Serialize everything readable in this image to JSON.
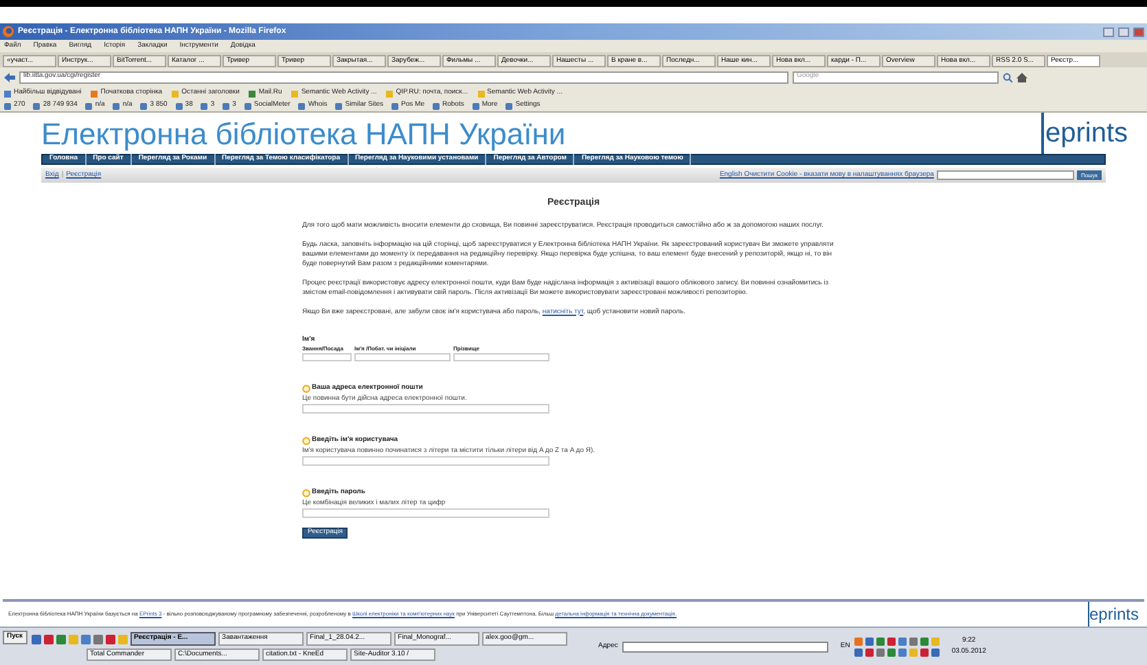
{
  "window": {
    "title": "Реєстрація - Електронна бібліотека НАПН України - Mozilla Firefox"
  },
  "menu": [
    "Файл",
    "Правка",
    "Вигляд",
    "Історія",
    "Закладки",
    "Інструменти",
    "Довідка"
  ],
  "tabs": [
    {
      "label": "«участ...",
      "selected": false
    },
    {
      "label": "Инструк...",
      "selected": false
    },
    {
      "label": "BitTorrent...",
      "selected": false
    },
    {
      "label": "Каталог ...",
      "selected": false
    },
    {
      "label": "Тривер",
      "selected": false
    },
    {
      "label": "Тривер",
      "selected": false
    },
    {
      "label": "Закрытая...",
      "selected": false
    },
    {
      "label": "Зарубеж...",
      "selected": false
    },
    {
      "label": "Фильмы ...",
      "selected": false
    },
    {
      "label": "Девочки...",
      "selected": false
    },
    {
      "label": "Нашесты ...",
      "selected": false
    },
    {
      "label": "В кране в...",
      "selected": false
    },
    {
      "label": "Последн...",
      "selected": false
    },
    {
      "label": "Наше кин...",
      "selected": false
    },
    {
      "label": "Нова вкл...",
      "selected": false
    },
    {
      "label": "карди - П...",
      "selected": false
    },
    {
      "label": "Overview",
      "selected": false
    },
    {
      "label": "Нова вкл...",
      "selected": false
    },
    {
      "label": "RSS 2.0 S...",
      "selected": false
    },
    {
      "label": "Реєстр...",
      "selected": true
    }
  ],
  "address": {
    "value": "lib.iitta.gov.ua/cgi/register"
  },
  "web_search": {
    "placeholder": "Google"
  },
  "bookmarks": [
    "Найбільш відвідувані",
    "Початкова сторінка",
    "Останні заголовки",
    "Mail.Ru",
    "Semantic Web Activity ...",
    "QIP.RU: почта, поиск...",
    "Semantic Web Activity ..."
  ],
  "seo_bar": [
    "270",
    "28 749 934",
    "n/a",
    "n/a",
    "3 850",
    "38",
    "3",
    "3",
    "SocialMeter",
    "Whois",
    "Similar Sites",
    "Pos Me",
    "Robots",
    "More",
    "Settings"
  ],
  "site": {
    "title": "Електронна бібліотека НАПН України",
    "logo": "eprints"
  },
  "nav": [
    "Головна",
    "Про сайт",
    "Перегляд за Роками",
    "Перегляд за Темою класифікатора",
    "Перегляд за Науковими установами",
    "Перегляд за Автором",
    "Перегляд за Науковою темою"
  ],
  "login_links": [
    "Вхід",
    "Реєстрація"
  ],
  "login_separator": "|",
  "language_note": "English Очистити Cookie - вказати мову в налаштуваннях браузера",
  "search_button": "Пошук",
  "page": {
    "heading": "Реєстрація",
    "paragraphs": [
      "Для того щоб мати можливість вносити елементи до сховища, Ви повинні зареєструватися. Реєстрація проводиться самостійно або ж за допомогою наших послуг.",
      "Будь ласка, заповніть інформацію на цій сторінці, щоб зареєструватися у Електронна бібліотека НАПН України. Як зареєстрований користувач Ви зможете управляти вашими елементами до моменту їх передавання на редакційну перевірку. Якщо перевірка буде успішна, то ваш елемент буде внесений у репозиторій, якщо ні, то він буде повернутий Вам разом з редакційними коментарями.",
      "Процес реєстрації використовує адресу електронної пошти, куди Вам буде надіслана інформація з активізації вашого облікового запису. Ви повинні ознайомитись із змістом email-повідомлення і активувати свій пароль. Після активізації Ви можете використовувати зареєстровані можливості репозиторію."
    ],
    "forgot": {
      "before": "Якщо Ви вже зареєстровані, але забули своє ім'я користувача або пароль,",
      "link": "натисніть тут",
      "after": ", щоб установити новий пароль."
    },
    "name_label": "Ім'я",
    "name_columns": [
      "Звання/Посада",
      "Ім'я /Побат. чи ініціали",
      "Прізвище"
    ],
    "fields": [
      {
        "label": "Ваша адреса електронної пошти",
        "help": "Це повинна бути дійсна адреса електронної пошти."
      },
      {
        "label": "Введіть ім'я користувача",
        "help": "Ім'я користувача повинно починатися з літери та містити тільки літери від A до Z та A до Я)."
      },
      {
        "label": "Введіть пароль",
        "help": "Це комбінація великих і малих літер та цифр"
      }
    ],
    "submit": "Реєстрація"
  },
  "footer": {
    "before": "Електронна бібліотека НАПН України базується на",
    "link1": "EPrints 3",
    "middle": "- вільно розповсюджуваному програмному забезпеченні, розробленому в",
    "link2": "Школі електроніки та комп'ютерних наук",
    "after": "при Університеті Саутгемптона. Більш",
    "link3": "детальна інформація та технічна документація.",
    "logo": "eprints"
  },
  "taskbar": {
    "start": "Пуск",
    "tasks": [
      {
        "label": "Реєстрація - Е...",
        "selected": true
      },
      {
        "label": "Завантаження",
        "selected": false
      },
      {
        "label": "Final_1_28.04.2...",
        "selected": false
      },
      {
        "label": "Final_Monograf...",
        "selected": false
      },
      {
        "label": "alex.goo@gm...",
        "selected": false
      }
    ],
    "tasks_row2": [
      "Total Commander",
      "C:\\Documents...",
      "citation.txt - KneEd",
      "Site-Auditor 3.10 /"
    ],
    "address_label": "Адрес",
    "lang": "EN",
    "time": "9:22",
    "date": "03.05.2012"
  }
}
